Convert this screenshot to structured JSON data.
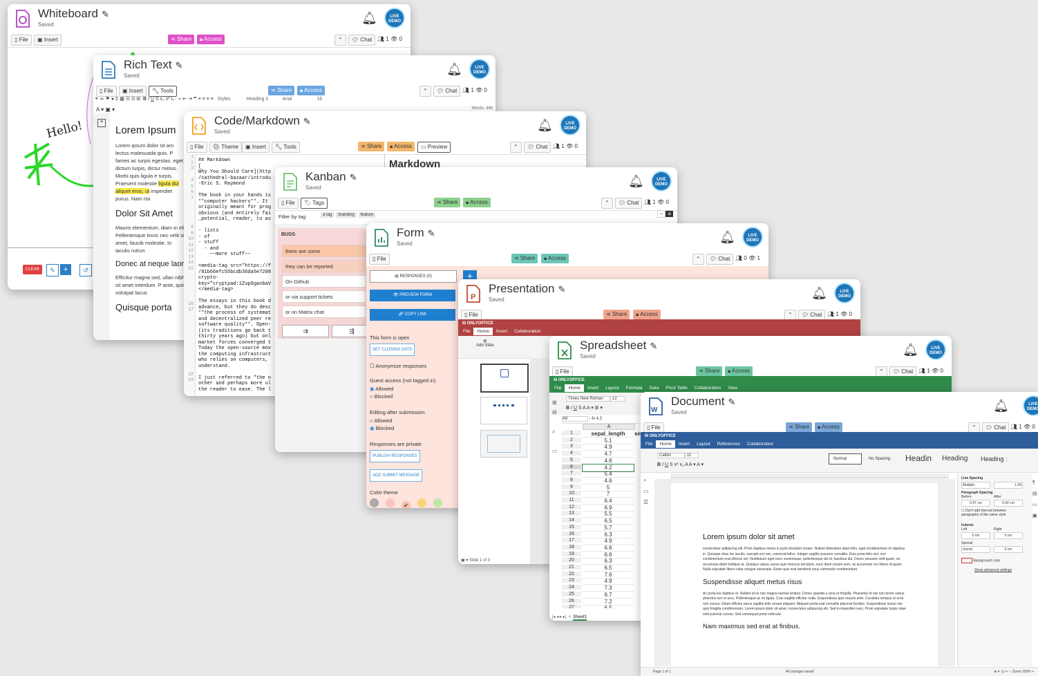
{
  "colors": {
    "whiteboard": "#b040c0",
    "share_pink": "#e050c8",
    "rich_text": "#2b79c2",
    "code": "#f0a020",
    "kanban": "#6ac06a",
    "form": "#2e8a6e",
    "presentation": "#c04b2d",
    "spreadsheet": "#2f8b4a",
    "document": "#2e5d9c",
    "share_blue": "#6aa6e0",
    "share_orange": "#f3b66c",
    "share_green": "#8cd08c",
    "share_teal": "#6cc6b6",
    "share_salmon": "#f1a48c"
  },
  "common": {
    "saved": "Saved",
    "share": "Share",
    "access": "Access",
    "chat": "Chat",
    "file": "File",
    "avatar": "LIVE DEMO",
    "bell_icon": "bell-icon"
  },
  "whiteboard": {
    "title": "Whiteboard",
    "insert": "Insert",
    "users": "1",
    "viewers": "0",
    "hello": "Hello!",
    "clear": "CLEAR"
  },
  "rich_text": {
    "title": "Rich Text",
    "insert": "Insert",
    "tools": "Tools",
    "users": "1",
    "viewers": "0",
    "styles": "Styles",
    "heading": "Heading 1",
    "font": "Arial",
    "size": "16",
    "words": "Words: 446",
    "h1": "Lorem Ipsum",
    "p1": "Lorem ipsum dolor sit am lectus malesuada quis. P fames ac turpis egestas. eget dictum turpis, dictur metus. Morbi quis ligula e turpis. Praesent molestie",
    "p1_highlight": "ligula dui aliquet eros, ut",
    "p1_end": "imperdiet purus. Nam risi",
    "h2": "Dolor Sit Amet",
    "p2": "Mauris elementum, diam in elit. Pellentesque tincic nec velit sit amet, faucib molestie. In iaculis rutrun",
    "h3": "Donec at neque laore",
    "p3": "Efficitur magna sed, ullan nibh sit amet interdum. P ante, quis volutpat lacus",
    "h4": "Quisque porta"
  },
  "code": {
    "title": "Code/Markdown",
    "theme": "Theme",
    "insert": "Insert",
    "tools": "Tools",
    "preview": "Preview",
    "users": "1",
    "viewers": "0",
    "preview_heading": "Markdown",
    "line_numbers": "1\n2\n3\n\n4\n5\n6\n7\n\n\n\n\n8\n9\n10\n11\n12\n13\n14\n15\n\n\n\n\n\n16\n17\n\n\n\n\n\n\n\n\n\n\n18\n19",
    "lines": "## Markdown\n[\nWhy You Should Care](http\n/cathedral-bazaar/introdu\n-Eric S. Raymond\n\nThe book in your hands is\n**computer hackers**. It\noriginally meant for prog\nobvious (and entirely fai\n_potential_ reader, to as\n\n- lists\n- of\n- stuff\n  - and\n    ~~more stuff~~\n\n<media-tag src=\"https://f\n/81b66efc55bcdb36da5e7208\ncrypto-\nkey=\"cryptpad:1ZupGganbaV\n</media-tag>\n\nThe essays in this book d\nadvance, but they do desc\n**the process of systemat\nand decentralized peer re\nsoftware quality**. Open-\n(its traditions go back t\nthirty years ago) but onl\nmarket forces converged t\nToday the open-source mov\nthe computing infrastruct\nwho relies on computers,\nunderstand.\n\nI just referred to \"the o\nother and perhaps more ul\nthe reader to ease. The l"
  },
  "kanban": {
    "title": "Kanban",
    "tags": "Tags",
    "users": "1",
    "viewers": "0",
    "filter": "Filter by tag",
    "tag_list": [
      "a tag",
      "branding",
      "feature"
    ],
    "column": "BUGS",
    "cards": [
      "there are some",
      "they can be reported",
      "On Github",
      "or via support tickets",
      "or on Matrix chat"
    ]
  },
  "form": {
    "title": "Form",
    "users": "0",
    "viewers": "1",
    "responses": "RESPONSES (0)",
    "preview_form": "PREVIEW FORM",
    "copy_link": "COPY LINK",
    "open": "This form is open",
    "set_closing": "SET CLOSING DATE",
    "anonymize": "Anonymize responses",
    "guest": "Guest access (not logged in)",
    "allowed": "Allowed",
    "blocked": "Blocked",
    "editing": "Editing after submission",
    "private": "Responses are private",
    "publish": "PUBLISH RESPONSES",
    "add_submit": "ADD SUBMIT MESSAGE",
    "color_theme": "Color theme"
  },
  "presentation": {
    "title": "Presentation",
    "users": "1",
    "viewers": "0",
    "brand": "ONLYOFFICE",
    "tabs": [
      "File",
      "Home",
      "Insert",
      "Collaboration"
    ],
    "add_slide": "Add Slide",
    "slide_status": "Slide 1 of 3"
  },
  "spreadsheet": {
    "title": "Spreadsheet",
    "users": "1",
    "viewers": "0",
    "brand": "ONLYOFFICE",
    "tabs": [
      "File",
      "Home",
      "Insert",
      "Layout",
      "Formula",
      "Data",
      "Pivot Table",
      "Collaboration",
      "View"
    ],
    "font": "Times New Roman",
    "size": "12",
    "cell_ref": "A6",
    "formula": "4.2",
    "col_header": "A",
    "col_b": "sep",
    "sheet": "Sheet1",
    "rows": [
      {
        "n": "1",
        "v": "sepal_length"
      },
      {
        "n": "2",
        "v": "5.1"
      },
      {
        "n": "3",
        "v": "4.9"
      },
      {
        "n": "4",
        "v": "4.7"
      },
      {
        "n": "5",
        "v": "4.6"
      },
      {
        "n": "6",
        "v": "4.2"
      },
      {
        "n": "7",
        "v": "5.4"
      },
      {
        "n": "8",
        "v": "4.6"
      },
      {
        "n": "9",
        "v": "5"
      },
      {
        "n": "10",
        "v": "7"
      },
      {
        "n": "11",
        "v": "6.4"
      },
      {
        "n": "12",
        "v": "6.9"
      },
      {
        "n": "13",
        "v": "5.5"
      },
      {
        "n": "14",
        "v": "6.5"
      },
      {
        "n": "15",
        "v": "5.7"
      },
      {
        "n": "16",
        "v": "6.3"
      },
      {
        "n": "17",
        "v": "4.9"
      },
      {
        "n": "18",
        "v": "6.6"
      },
      {
        "n": "19",
        "v": "6.6"
      },
      {
        "n": "20",
        "v": "6.3"
      },
      {
        "n": "21",
        "v": "6.5"
      },
      {
        "n": "22",
        "v": "7.6"
      },
      {
        "n": "23",
        "v": "4.9"
      },
      {
        "n": "24",
        "v": "7.3"
      },
      {
        "n": "25",
        "v": "6.7"
      },
      {
        "n": "26",
        "v": "7.2"
      },
      {
        "n": "27",
        "v": "6.5"
      }
    ]
  },
  "document": {
    "title": "Document",
    "users": "1",
    "viewers": "0",
    "brand": "ONLYOFFICE",
    "tabs": [
      "File",
      "Home",
      "Insert",
      "Layout",
      "References",
      "Collaboration"
    ],
    "font": "Calibri",
    "size": "11",
    "styles": [
      "Normal",
      "No Spacing",
      "Headin",
      "Heading",
      "Heading :"
    ],
    "h1": "Lorem ipsum dolor sit amet",
    "p1": "consectetur adipiscing elit. Proin dapibus metus in justo tincidunt ornare. Nullam bibendum diam felis, eget condimentum mi dapibus in. Quisque vitae leo iaculis, suscipit orci nec, euismod tellus. Integer sagittis posuere convallis. Duis porta felis nisl, non condimentum erat ultrices vel. Vestibulum eget nunc scelerisque, pellentesque dui id, faucibus dui. Donec posuere velit quam, eu accumsan diam tristique at. Quisque varius, purus quis rhoncus tincidunt, nunc diam ornare sem, ac accumsan orci libero id quam. Nulla vulputate libero vitae congue venenatis. Etiam quis erat hendrerit risus commodo condimentum.",
    "h2": "Suspendisse aliquet metus risus",
    "p2": "Ac porta leo dapibus et. Nullam id ex non magna laoreet tempor. Donec gravida a urna et fringilla. Phasellus id nisl non lorem varius pharetra non et arcu. Pellentesque ac mi ligula. Cras sagittis efficitur nulla. Suspendisse quis mauris ante. Curabitur tempus ut urna non cursus. Etiam efficitur purus sagittis felis ornare aliquam. Aliquam porta erat convallis placerat facilisis. Suspendisse luctus nisi quis fringilla condimentum. Lorem ipsum dolor sit amet, consectetur adipiscing elit. Sed in imperdiet nunc. Proin vulputate turpis vitae velit pulvinar cursus. Sed consequat porta vehicula.",
    "h3": "Nam maximus sed erat at finibus.",
    "page": "Page 1 of 1",
    "status": "All changes saved",
    "zoom": "Zoom 100%",
    "panel": {
      "line_spacing": "Line Spacing",
      "multiple": "Multiple",
      "line_val": "1.08",
      "para_spacing": "Paragraph Spacing",
      "before": "Before",
      "after": "After",
      "before_val": "0.47 cm",
      "after_val": "0.42 cm",
      "dont_add": "Don't add interval between paragraphs of the same style",
      "indents": "Indents",
      "left": "Left",
      "right": "Right",
      "left_val": "0 cm",
      "right_val": "0 cm",
      "special": "Special",
      "none": "(none)",
      "special_val": "0 cm",
      "background": "Background color",
      "advanced": "Show advanced settings"
    }
  }
}
